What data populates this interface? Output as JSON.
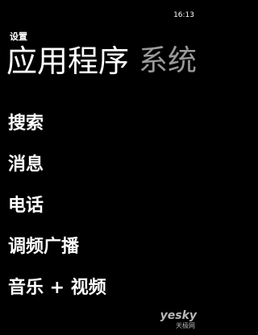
{
  "status_bar": {
    "clock": "16:13"
  },
  "header": {
    "app_title": "设置"
  },
  "pivot": {
    "active": "应用程序",
    "next": "系统"
  },
  "items": [
    {
      "label": "搜索"
    },
    {
      "label": "消息"
    },
    {
      "label": "电话"
    },
    {
      "label": "调频广播"
    },
    {
      "label": "音乐 + 视频"
    }
  ],
  "watermark": {
    "brand": "yesky",
    "subtitle": "天极网"
  },
  "colors": {
    "background": "#000000",
    "foreground": "#ffffff",
    "inactive": "#9a9a9a"
  }
}
